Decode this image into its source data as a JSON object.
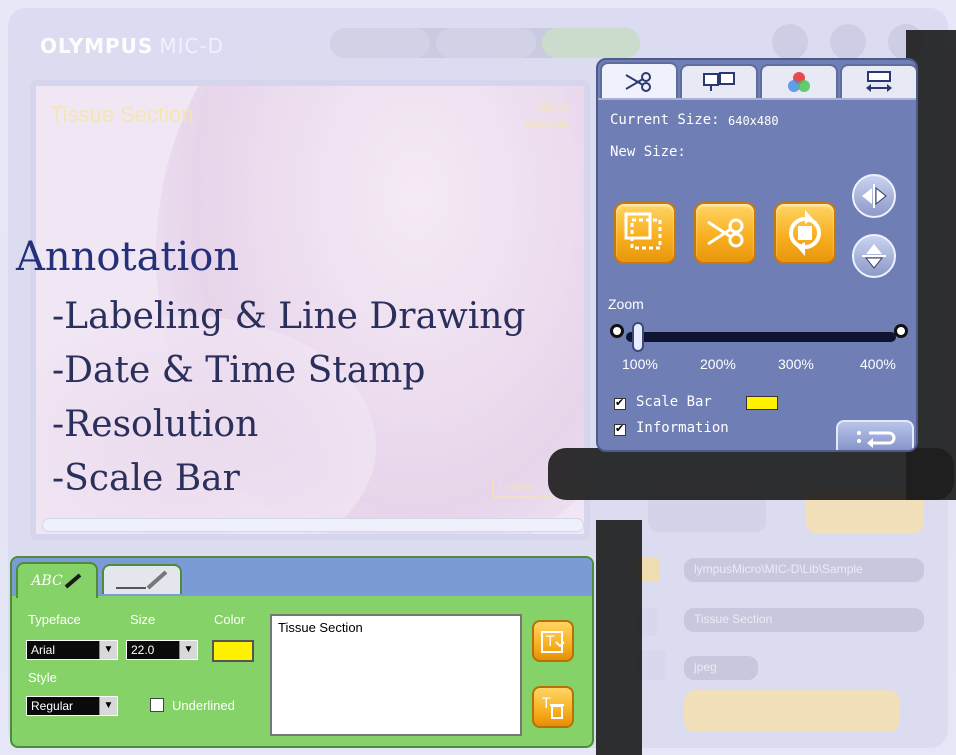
{
  "app": {
    "brand_bold": "OLYMPUS",
    "brand_name": "MIC-D"
  },
  "preview": {
    "image_label": "Tissue Section",
    "info_line1": "MIC-D",
    "info_line2": "640x480",
    "scale_text": "100µm"
  },
  "annotation": {
    "title": "Annotation",
    "items": [
      "-Labeling & Line Drawing",
      "-Date & Time Stamp",
      "-Resolution",
      "-Scale Bar"
    ]
  },
  "resize_panel": {
    "tabs": [
      "scissors-icon",
      "monitor-icon",
      "color-icon",
      "transfer-icon"
    ],
    "current_size_label": "Current Size:",
    "current_size_value": "640x480",
    "new_size_label": "New Size:",
    "zoom_label": "Zoom",
    "zoom_ticks": [
      "100%",
      "200%",
      "300%",
      "400%"
    ],
    "zoom_value": "100%",
    "scale_bar_label": "Scale Bar",
    "scale_bar_checked": true,
    "scale_bar_color": "#fff200",
    "information_label": "Information",
    "information_checked": true
  },
  "side_fields": {
    "path_value": "lympusMicro\\MIC-D\\Lib\\Sample",
    "title_value": "Tissue Section",
    "format_value": "jpeg"
  },
  "tool_panel": {
    "tab_text_label": "ABC",
    "typeface_label": "Typeface",
    "typeface_value": "Arial",
    "size_label": "Size",
    "size_value": "22.0",
    "color_label": "Color",
    "color_value": "#fff200",
    "style_label": "Style",
    "style_value": "Regular",
    "underlined_label": "Underlined",
    "underlined_checked": false,
    "text_value": "Tissue Section"
  }
}
